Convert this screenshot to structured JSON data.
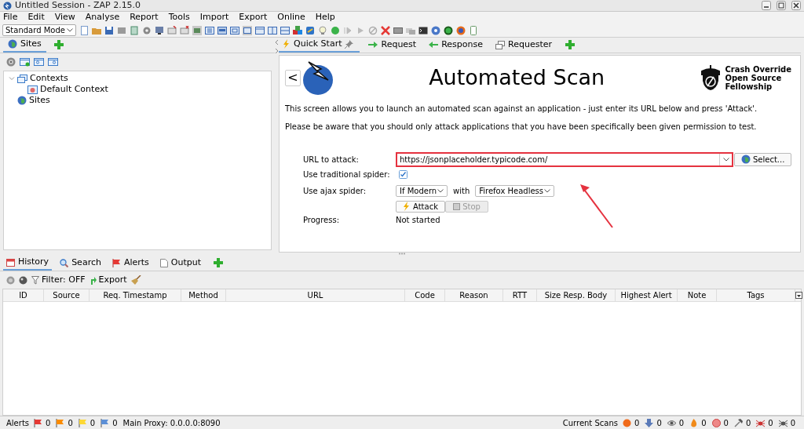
{
  "window": {
    "title": "Untitled Session - ZAP 2.15.0"
  },
  "menu": [
    "File",
    "Edit",
    "View",
    "Analyse",
    "Report",
    "Tools",
    "Import",
    "Export",
    "Online",
    "Help"
  ],
  "toolbar": {
    "mode": "Standard Mode"
  },
  "sites_panel": {
    "tabs": [
      {
        "label": "Sites",
        "selected": true
      }
    ],
    "tree": [
      {
        "label": "Contexts",
        "kind": "contexts",
        "expanded": true,
        "children": [
          {
            "label": "Default Context",
            "kind": "context"
          }
        ]
      },
      {
        "label": "Sites",
        "kind": "sites"
      }
    ]
  },
  "workspace": {
    "tabs": [
      {
        "label": "Quick Start",
        "kind": "bolt",
        "selected": true
      },
      {
        "label": "Request",
        "kind": "right",
        "selected": false
      },
      {
        "label": "Response",
        "kind": "left",
        "selected": false
      },
      {
        "label": "Requester",
        "kind": "windows",
        "selected": false
      }
    ],
    "back": "<",
    "title": "Automated Scan",
    "sponsor": [
      "Crash Override",
      "Open Source",
      "Fellowship"
    ],
    "intro": [
      "This screen allows you to launch an automated scan against  an application - just enter its URL below and press 'Attack'.",
      "Please be aware that you should only attack applications that you have been specifically been given permission to test."
    ],
    "form": {
      "url_label": "URL to attack:",
      "url_value": "https://jsonplaceholder.typicode.com/",
      "select": "Select...",
      "traditional_label": "Use traditional spider:",
      "traditional_checked": true,
      "ajax_label": "Use ajax spider:",
      "ajax_mode": "If Modern",
      "with": "with",
      "browser": "Firefox Headless",
      "attack": "Attack",
      "stop": "Stop",
      "stop_disabled": true,
      "progress_label": "Progress:",
      "progress_value": "Not started"
    }
  },
  "bottom": {
    "tabs": [
      {
        "label": "History",
        "kind": "calendar",
        "selected": true
      },
      {
        "label": "Search",
        "kind": "search",
        "selected": false
      },
      {
        "label": "Alerts",
        "kind": "flag",
        "selected": false
      },
      {
        "label": "Output",
        "kind": "page",
        "selected": false
      }
    ],
    "filter": "Filter: OFF",
    "export": "Export",
    "columns": [
      "ID",
      "Source",
      "Req. Timestamp",
      "Method",
      "URL",
      "Code",
      "Reason",
      "RTT",
      "Size Resp. Body",
      "Highest Alert",
      "Note",
      "Tags"
    ]
  },
  "status_bar": {
    "alerts_label": "Alerts",
    "alerts": [
      {
        "color": "#e53935",
        "count": "0"
      },
      {
        "color": "#fb8c00",
        "count": "0"
      },
      {
        "color": "#fdd835",
        "count": "0"
      },
      {
        "color": "#5c8fd6",
        "count": "0"
      }
    ],
    "proxy": "Main Proxy: 0.0.0.0:8090",
    "scans_label": "Current Scans",
    "scans": [
      {
        "kind": "sun",
        "count": "0"
      },
      {
        "kind": "download",
        "count": "0"
      },
      {
        "kind": "eye",
        "count": "0"
      },
      {
        "kind": "flame",
        "count": "0"
      },
      {
        "kind": "dot",
        "count": "0"
      },
      {
        "kind": "hammer",
        "count": "0"
      },
      {
        "kind": "spider",
        "count": "0"
      },
      {
        "kind": "bug",
        "count": "0"
      }
    ]
  }
}
